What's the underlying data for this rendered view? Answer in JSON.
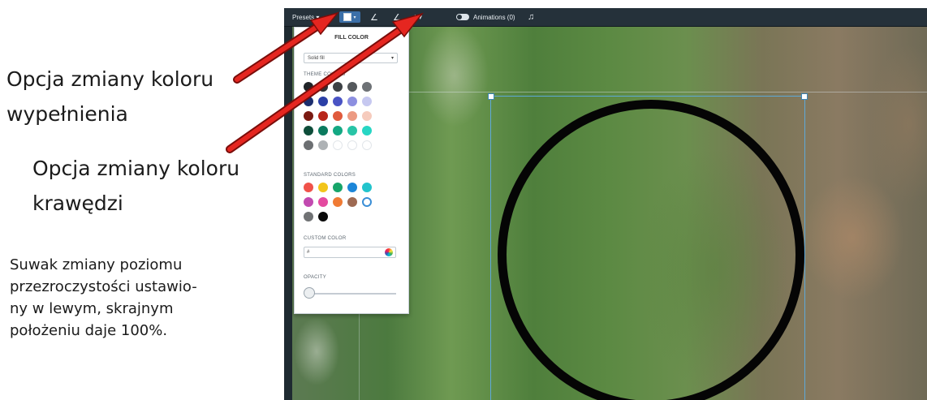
{
  "annotations": {
    "fill_option": [
      "Opcja zmiany koloru",
      "wypełnienia"
    ],
    "stroke_option": [
      "Opcja zmiany koloru",
      "krawędzi"
    ],
    "opacity_note": [
      "Suwak zmiany poziomu",
      "przezroczystości ustawio-",
      "ny w lewym, skrajnym",
      "położeniu daje 100%."
    ]
  },
  "toolbar": {
    "presets_label": "Presets ▾",
    "fill_color_icon": "filled-square-icon",
    "stroke_color_icon": "pen-icon",
    "line_style_icon": "pen-line-icon",
    "stroke_width_label": "⁝ ▾",
    "animations_label": "Animations (0)",
    "music_icon": "music-note-icon"
  },
  "fill_panel": {
    "title": "FILL COLOR",
    "fill_type": "Solid fill",
    "theme_colors_label": "THEME COLORS",
    "theme_colors": [
      "#202428",
      "#2e3236",
      "#3d4145",
      "#54585c",
      "#6e7276",
      "#1c2e6e",
      "#2b3fa6",
      "#4953c4",
      "#8c8fe0",
      "#c6c8f0",
      "#7a1a12",
      "#b8261a",
      "#e05a3c",
      "#ec9a82",
      "#f6cbbd",
      "#0e4d3a",
      "#0b7a5e",
      "#14a883",
      "#28c4a6",
      "#27d6c4",
      "#6c6f72",
      "#aeb2b5",
      "#ffffff",
      "#ffffff",
      "#ffffff"
    ],
    "standard_colors_label": "STANDARD COLORS",
    "standard_colors": [
      "#f0524a",
      "#f2c51a",
      "#17a56a",
      "#1c86d8",
      "#22c4cc",
      "#c24ab0",
      "#e44aa0",
      "#f07b34",
      "#9e6a52",
      "outline",
      "#707274",
      "#0a0a0a"
    ],
    "custom_color_label": "CUSTOM COLOR",
    "custom_color_value": "#",
    "opacity_label": "OPACITY",
    "opacity_percent": 100
  },
  "colors": {
    "arrow": "#e52620",
    "selection": "#5ea9d8",
    "shape_stroke": "#050505"
  }
}
